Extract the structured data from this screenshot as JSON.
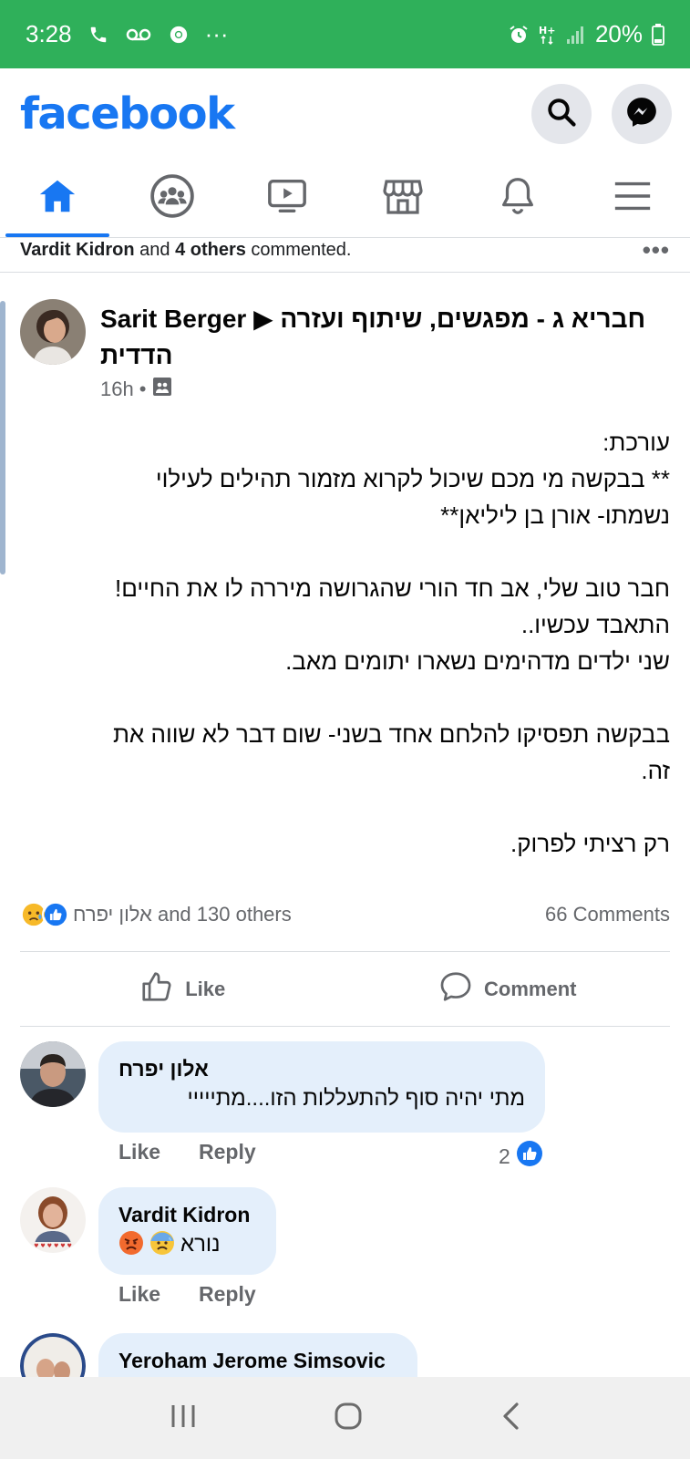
{
  "status_bar": {
    "time": "3:28",
    "left_icons": [
      "phone-icon",
      "voicemail-icon",
      "chrome-icon",
      "more-icon"
    ],
    "more_label": "···",
    "right_icons": [
      "alarm-icon",
      "hplus-icon",
      "signal-icon"
    ],
    "battery": "20%",
    "bg_color": "#2fb05a"
  },
  "header": {
    "logo": "facebook",
    "brand_color": "#1877f2",
    "buttons": [
      "search-icon",
      "messenger-icon"
    ]
  },
  "nav_tabs": [
    {
      "name": "home",
      "icon": "home-icon",
      "active": true
    },
    {
      "name": "groups",
      "icon": "groups-icon",
      "active": false
    },
    {
      "name": "watch",
      "icon": "video-icon",
      "active": false
    },
    {
      "name": "marketplace",
      "icon": "store-icon",
      "active": false
    },
    {
      "name": "notifications",
      "icon": "bell-icon",
      "active": false
    },
    {
      "name": "menu",
      "icon": "hamburger-icon",
      "active": false
    }
  ],
  "activity": {
    "name": "Vardit Kidron",
    "connector": " and ",
    "others": "4 others",
    "suffix": " commented.",
    "more": "•••"
  },
  "post": {
    "author": "Sarit Berger",
    "arrow": "▶",
    "group": "חבריא ג - מפגשים, שיתוף ועזרה הדדית",
    "time": "16h",
    "separator": "•",
    "privacy_icon": "group-privacy-icon",
    "body_lines": [
      "עורכת:",
      "** בבקשה מי מכם שיכול לקרוא מזמור תהילים לעילוי",
      "נשמתו- אורן בן ליליאן**",
      "",
      "חבר טוב שלי, אב חד הורי שהגרושה מיררה לו את החיים!",
      "התאבד עכשיו..",
      "שני ילדים מדהימים נשארו יתומים מאב.",
      "",
      "בבקשה תפסיקו להלחם אחד בשני- שום דבר לא שווה את",
      "זה.",
      "",
      "רק רציתי לפרוק."
    ],
    "reactions": {
      "icons": [
        "sad-reaction-icon",
        "like-reaction-icon"
      ],
      "text": "אלון יפרח and 130 others",
      "comments": "66 Comments"
    },
    "actions": {
      "like": "Like",
      "comment": "Comment"
    }
  },
  "comments": [
    {
      "author": "אלון יפרח",
      "text": "מתי יהיה סוף להתעללות הזו....מתייייי",
      "like": "Like",
      "reply": "Reply",
      "likes": "2"
    },
    {
      "author": "Vardit Kidron",
      "text": "נורא",
      "emojis": [
        "angry-face-icon",
        "anxious-face-icon"
      ],
      "like": "Like",
      "reply": "Reply"
    },
    {
      "author": "Yeroham Jerome Simsovic"
    }
  ],
  "android_nav": [
    "recents-icon",
    "home-circle-icon",
    "back-icon"
  ]
}
